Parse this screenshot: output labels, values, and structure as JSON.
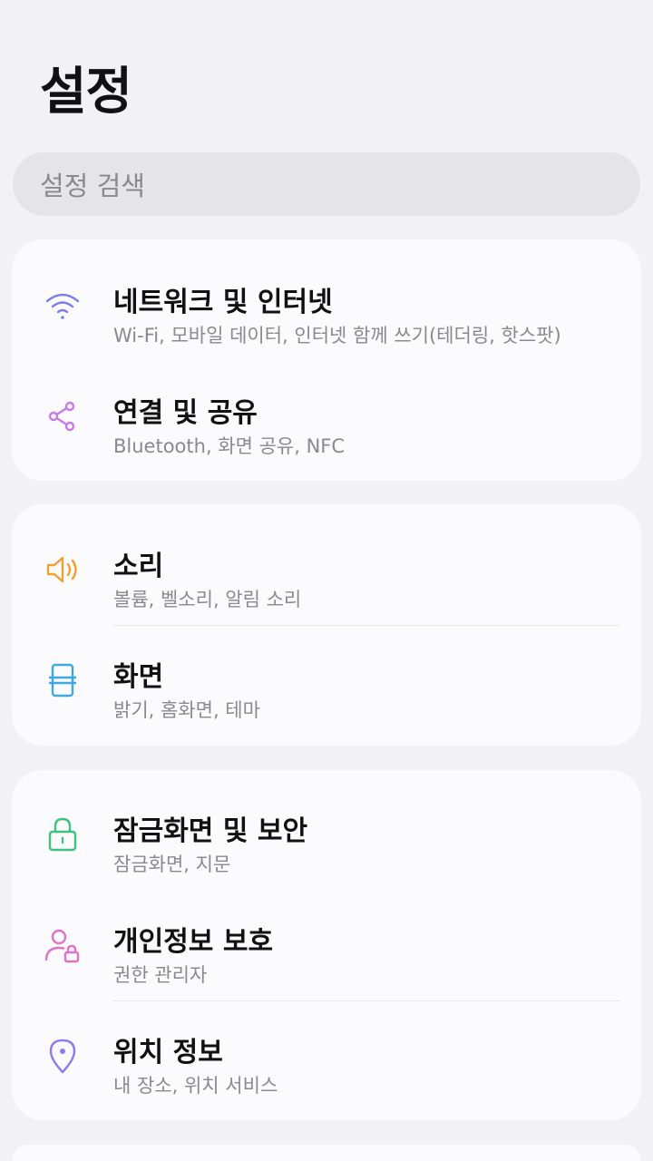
{
  "page": {
    "title": "설정"
  },
  "search": {
    "placeholder": "설정 검색"
  },
  "groups": [
    {
      "items": [
        {
          "title": "네트워크 및 인터넷",
          "subtitle": "Wi-Fi, 모바일 데이터, 인터넷 함께 쓰기(테더링, 핫스팟)",
          "icon": "wifi-icon",
          "color": "#7b7cf0"
        },
        {
          "title": "연결 및 공유",
          "subtitle": "Bluetooth, 화면 공유, NFC",
          "icon": "share-icon",
          "color": "#c77ae8"
        }
      ]
    },
    {
      "items": [
        {
          "title": "소리",
          "subtitle": "볼륨, 벨소리, 알림 소리",
          "icon": "speaker-icon",
          "color": "#f0a030"
        },
        {
          "title": "화면",
          "subtitle": "밝기, 홈화면, 테마",
          "icon": "display-icon",
          "color": "#3ea9e0"
        }
      ]
    },
    {
      "items": [
        {
          "title": "잠금화면 및 보안",
          "subtitle": "잠금화면, 지문",
          "icon": "lock-icon",
          "color": "#3cc27a"
        },
        {
          "title": "개인정보 보호",
          "subtitle": "권한 관리자",
          "icon": "user-lock-icon",
          "color": "#e070c8"
        },
        {
          "title": "위치 정보",
          "subtitle": "내 장소, 위치 서비스",
          "icon": "location-pin-icon",
          "color": "#8a7cf0"
        }
      ]
    }
  ]
}
